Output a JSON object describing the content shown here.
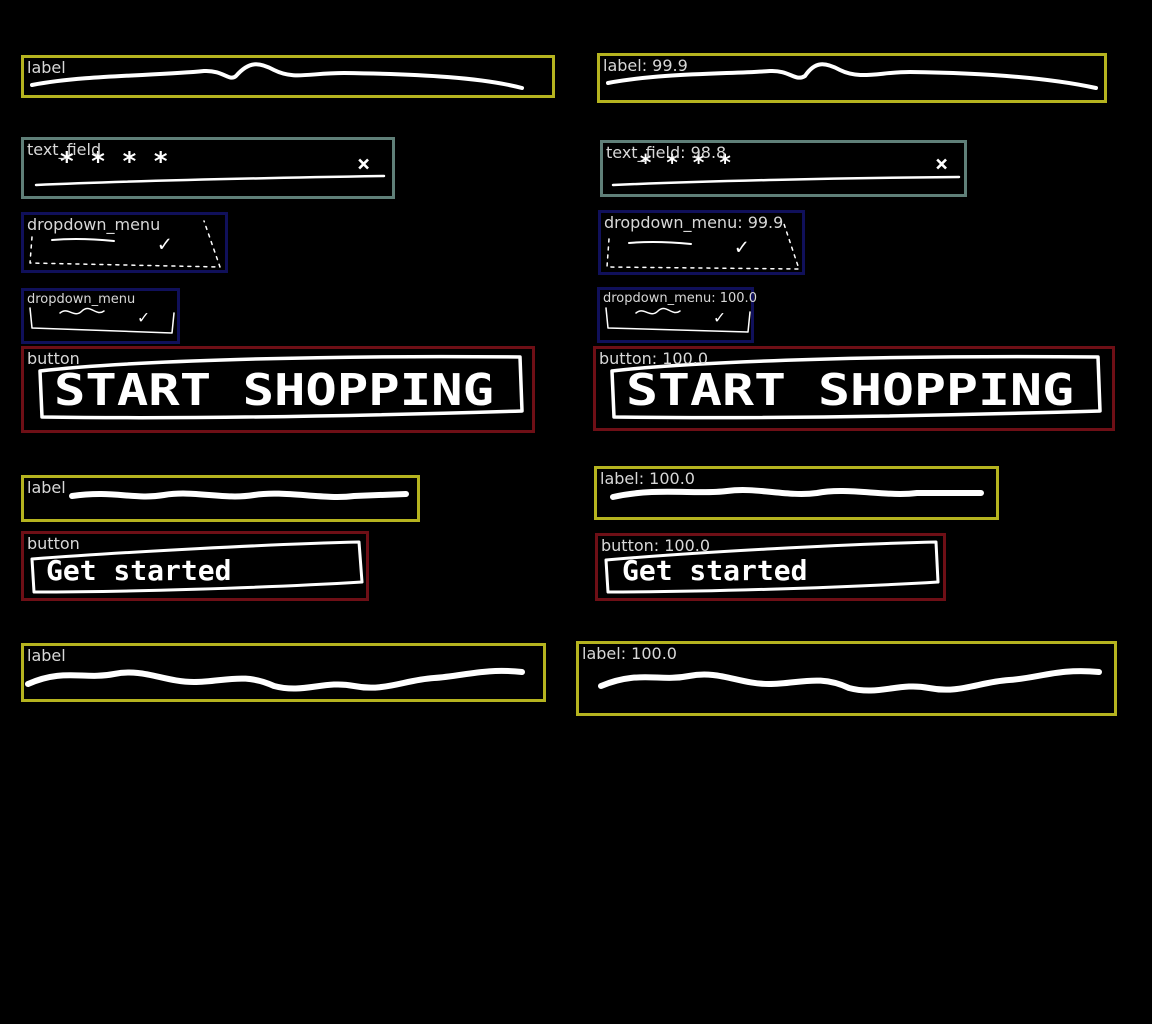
{
  "colors": {
    "label": "#b5b31f",
    "text_field": "#5f7f78",
    "dropdown_menu": "#10105a",
    "button": "#6e0f16",
    "background": "#000000"
  },
  "left": {
    "label_1": "label",
    "text_field": "text_field",
    "dropdown_1": "dropdown_menu",
    "dropdown_2": "dropdown_menu",
    "button_1": "button",
    "label_2": "label",
    "button_2": "button",
    "label_3": "label"
  },
  "right": {
    "label_1": "label: 99.9",
    "text_field": "text_field: 98.8",
    "dropdown_1": "dropdown_menu: 99.9",
    "dropdown_2": "dropdown_menu: 100.0",
    "button_1": "button: 100.0",
    "label_2": "label: 100.0",
    "button_2": "button: 100.0",
    "label_3": "label: 100.0"
  },
  "sketch": {
    "password_mask": "* * * *",
    "clear_glyph": "×",
    "check_glyph": "✓",
    "button_1_text": "START SHOPPING",
    "button_2_text": "Get started"
  }
}
